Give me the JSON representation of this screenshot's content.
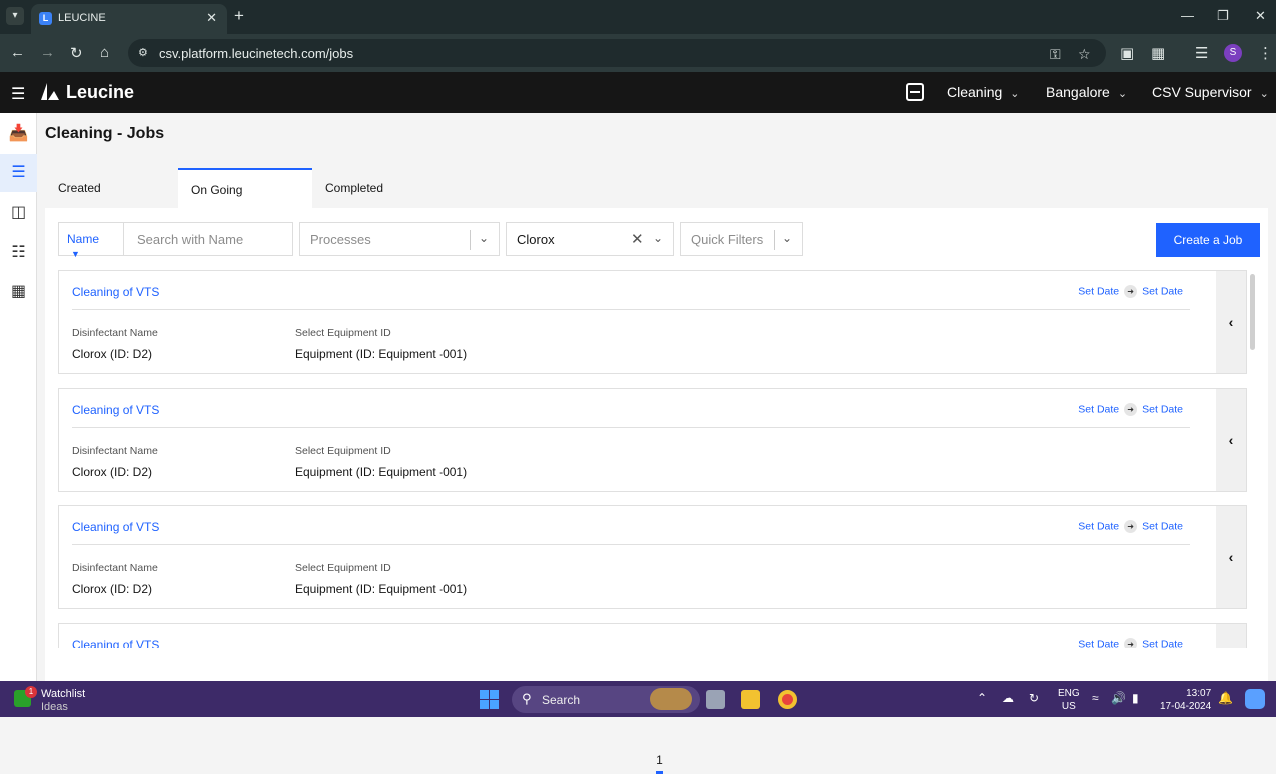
{
  "browser": {
    "tab_title": "LEUCINE",
    "url": "csv.platform.leucinetech.com/jobs",
    "profile_initial": "S"
  },
  "header": {
    "logo_text": "Leucine",
    "module": "Cleaning",
    "location": "Bangalore",
    "role": "CSV Supervisor"
  },
  "page": {
    "title": "Cleaning - Jobs",
    "tabs": [
      {
        "label": "Created",
        "active": false
      },
      {
        "label": "On Going",
        "active": true
      },
      {
        "label": "Completed",
        "active": false
      }
    ]
  },
  "filters": {
    "name_label": "Name",
    "search_placeholder": "Search with Name",
    "processes_placeholder": "Processes",
    "selected_value": "Clorox",
    "quick_filters_placeholder": "Quick Filters",
    "create_button": "Create a Job"
  },
  "jobs": [
    {
      "name": "Cleaning of VTS",
      "start": "Set Date",
      "end": "Set Date",
      "field1_label": "Disinfectant Name",
      "field1_value": "Clorox (ID: D2)",
      "field2_label": "Select Equipment ID",
      "field2_value": "Equipment (ID: Equipment -001)"
    },
    {
      "name": "Cleaning of VTS",
      "start": "Set Date",
      "end": "Set Date",
      "field1_label": "Disinfectant Name",
      "field1_value": "Clorox (ID: D2)",
      "field2_label": "Select Equipment ID",
      "field2_value": "Equipment (ID: Equipment -001)"
    },
    {
      "name": "Cleaning of VTS",
      "start": "Set Date",
      "end": "Set Date",
      "field1_label": "Disinfectant Name",
      "field1_value": "Clorox (ID: D2)",
      "field2_label": "Select Equipment ID",
      "field2_value": "Equipment (ID: Equipment -001)"
    },
    {
      "name": "Cleaning of VTS",
      "start": "Set Date",
      "end": "Set Date"
    }
  ],
  "pagination": {
    "current": "1"
  },
  "taskbar": {
    "widget_title": "Watchlist",
    "widget_sub": "Ideas",
    "widget_badge": "1",
    "search_label": "Search",
    "lang": "ENG",
    "region": "US",
    "time": "13:07",
    "date": "17-04-2024"
  }
}
